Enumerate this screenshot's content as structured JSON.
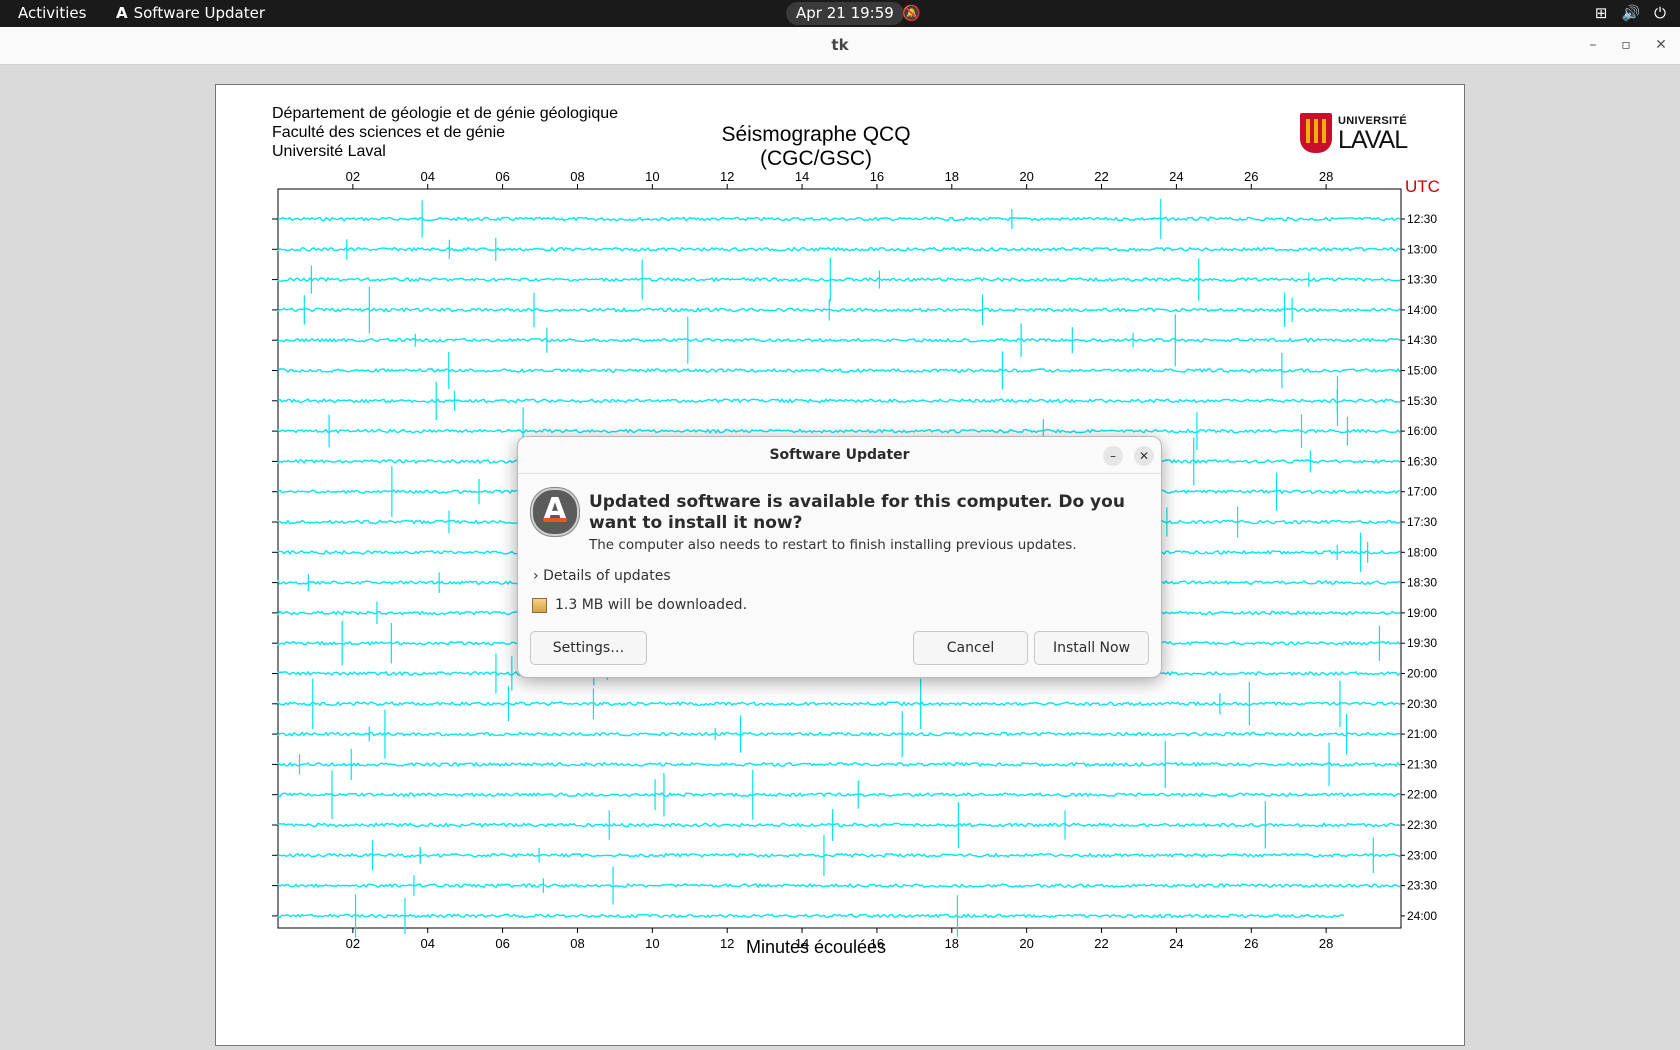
{
  "topbar": {
    "activities": "Activities",
    "app_name": "Software Updater",
    "clock": "Apr 21  19:59"
  },
  "window": {
    "title": "tk"
  },
  "figure": {
    "header_lines": [
      "Département de géologie et de génie géologique",
      "Faculté des sciences et de génie",
      "Université Laval"
    ],
    "title": "Séismographe QCQ (CGC/GSC)",
    "logo_top": "UNIVERSITÉ",
    "logo_main": "LAVAL",
    "utc_label": "UTC",
    "x_label": "Minutes écoulées",
    "x_ticks": [
      "02",
      "04",
      "06",
      "08",
      "10",
      "12",
      "14",
      "16",
      "18",
      "20",
      "22",
      "24",
      "26",
      "28"
    ],
    "row_labels": [
      "12:30",
      "13:00",
      "13:30",
      "14:00",
      "14:30",
      "15:00",
      "15:30",
      "16:00",
      "16:30",
      "17:00",
      "17:30",
      "18:00",
      "18:30",
      "19:00",
      "19:30",
      "20:00",
      "20:30",
      "21:00",
      "21:30",
      "22:00",
      "22:30",
      "23:00",
      "23:30",
      "24:00"
    ],
    "trace_color": "#00e5ee",
    "utc_color": "#d00000"
  },
  "dialog": {
    "title": "Software Updater",
    "headline": "Updated software is available for this computer. Do you want to install it now?",
    "subtext": "The computer also needs to restart to finish installing previous updates.",
    "details_label": "Details of updates",
    "download_text": "1.3 MB will be downloaded.",
    "settings_label": "Settings…",
    "cancel_label": "Cancel",
    "install_label": "Install Now"
  }
}
